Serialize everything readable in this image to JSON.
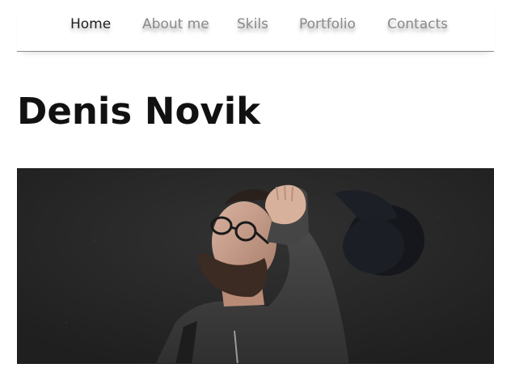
{
  "nav": {
    "items": [
      {
        "label": "Home",
        "active": true
      },
      {
        "label": "About me",
        "active": false
      },
      {
        "label": "Skils",
        "active": false
      },
      {
        "label": "Portfolio",
        "active": false
      },
      {
        "label": "Contacts",
        "active": false
      }
    ]
  },
  "hero": {
    "title": "Denis Novik"
  },
  "colors": {
    "nav_active": "#1e1e1e",
    "nav_inactive": "#8a8a8a",
    "title": "#111111",
    "photo_background": "#262626"
  }
}
